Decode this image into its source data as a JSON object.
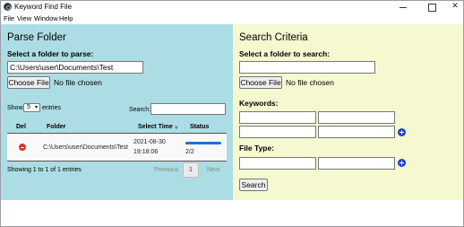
{
  "window": {
    "title": "Keyword Find File"
  },
  "menu": [
    "File",
    "View",
    "Window",
    "Help"
  ],
  "parse": {
    "title": "Parse Folder",
    "folder_label": "Select a folder to parse:",
    "folder_value": "C:\\Users\\user\\Documents\\Test",
    "choose_label": "Choose File",
    "no_file": "No file chosen",
    "show_label": "Show",
    "entries_value": "5",
    "entries_label": "entries",
    "search_label": "Search:",
    "search_value": "",
    "columns": [
      "Del",
      "Folder",
      "Select Time",
      "Status"
    ],
    "rows": [
      {
        "folder": "C:\\Users\\user\\Documents\\Test",
        "time_date": "2021-08-30",
        "time_clock": "19:18:06",
        "status": "2/2",
        "progress": 1.0
      }
    ],
    "info": "Showing 1 to 1 of 1 entries",
    "previous": "Previous",
    "page": "1",
    "next": "Next"
  },
  "criteria": {
    "title": "Search Criteria",
    "folder_label": "Select a folder to search:",
    "folder_value": "",
    "choose_label": "Choose File",
    "no_file": "No file chosen",
    "keywords_label": "Keywords:",
    "keywords": [
      "",
      "",
      "",
      ""
    ],
    "file_type_label": "File Type:",
    "file_types": [
      "",
      ""
    ],
    "search_button": "Search"
  },
  "colors": {
    "parse_bg": "#acdde4",
    "criteria_bg": "#f6f8d0",
    "progress": "#1a6fd1",
    "delete": "#d9322b",
    "add": "#1b3fd6"
  }
}
